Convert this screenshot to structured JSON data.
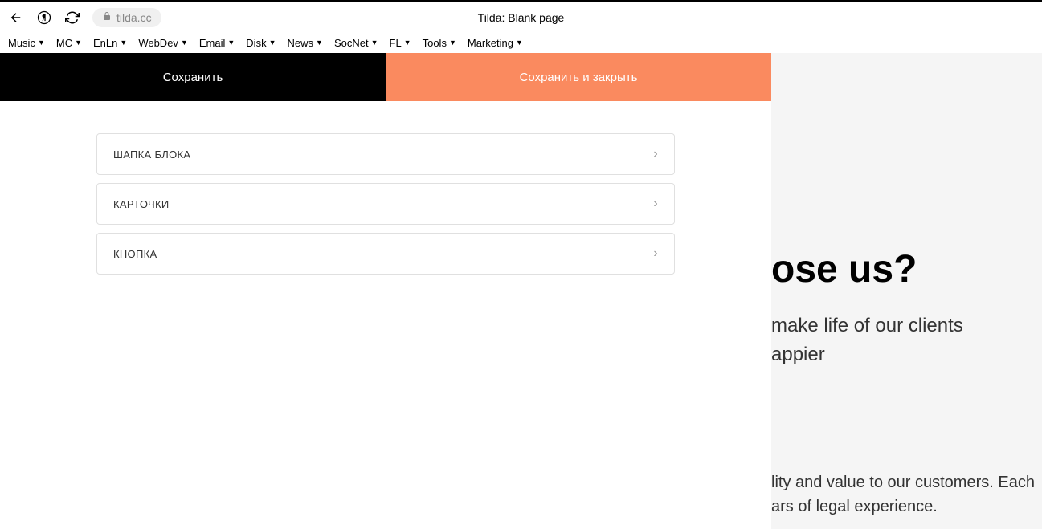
{
  "browser": {
    "url": "tilda.cc",
    "page_title": "Tilda: Blank page"
  },
  "bookmarks": [
    "Music",
    "MC",
    "EnLn",
    "WebDev",
    "Email",
    "Disk",
    "News",
    "SocNet",
    "FL",
    "Tools",
    "Marketing"
  ],
  "editor": {
    "save_label": "Сохранить",
    "save_close_label": "Сохранить и закрыть",
    "items": [
      "ШАПКА БЛОКА",
      "КАРТОЧКИ",
      "КНОПКА"
    ]
  },
  "preview": {
    "heading": "ose us?",
    "sub1_line1": "make life of our clients",
    "sub1_line2": "appier",
    "sub2_line1": "lity and value to our customers. Each",
    "sub2_line2": "ars of legal experience."
  }
}
